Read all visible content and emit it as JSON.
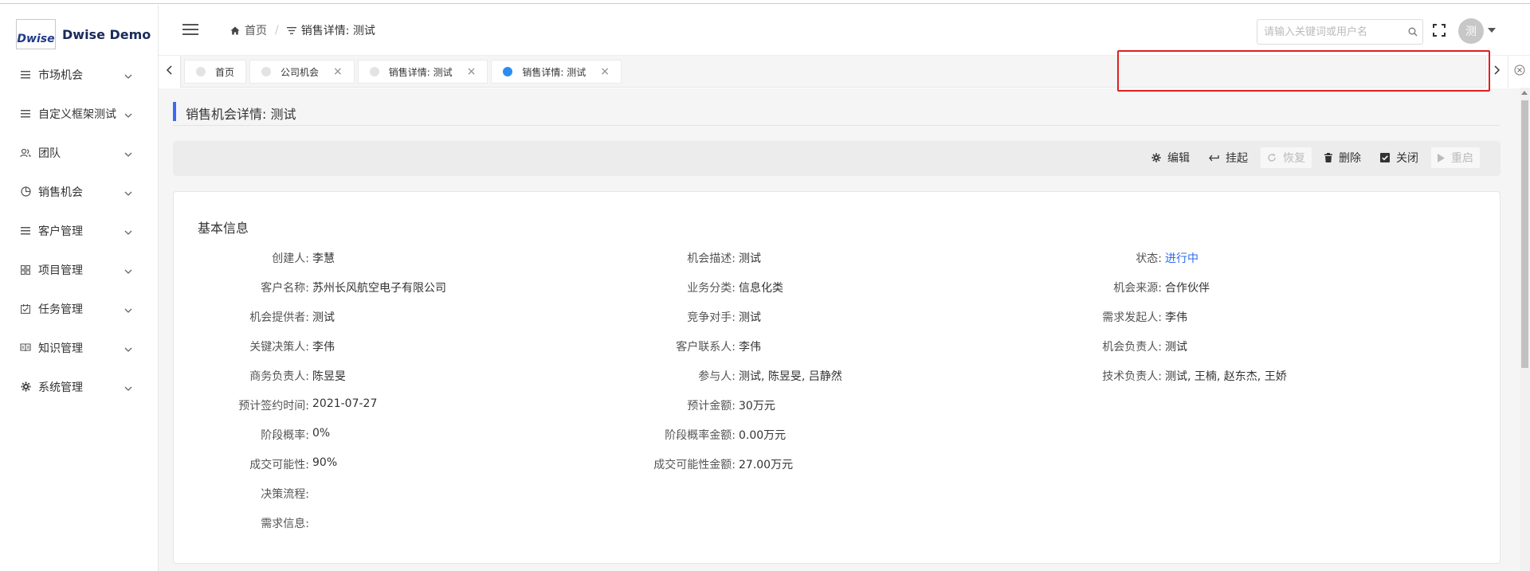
{
  "app": {
    "logo_mark": "Dwise",
    "name": "Dwise Demo"
  },
  "sidebar": {
    "items": [
      {
        "label": "市场机会",
        "icon": "list-icon"
      },
      {
        "label": "自定义框架测试",
        "icon": "list-icon"
      },
      {
        "label": "团队",
        "icon": "team-icon"
      },
      {
        "label": "销售机会",
        "icon": "pie-chart-icon"
      },
      {
        "label": "客户管理",
        "icon": "list-icon"
      },
      {
        "label": "项目管理",
        "icon": "grid-icon"
      },
      {
        "label": "任务管理",
        "icon": "checkbox-icon"
      },
      {
        "label": "知识管理",
        "icon": "book-icon"
      },
      {
        "label": "系统管理",
        "icon": "gear-icon"
      }
    ]
  },
  "header": {
    "breadcrumb": {
      "home": "首页",
      "current": "销售详情: 测试"
    },
    "search": {
      "placeholder": "请输入关键词或用户名",
      "value": ""
    },
    "avatar": "测"
  },
  "tabs": [
    {
      "label": "首页",
      "closable": false,
      "active": false
    },
    {
      "label": "公司机会",
      "closable": true,
      "active": false
    },
    {
      "label": "销售详情: 测试",
      "closable": true,
      "active": false
    },
    {
      "label": "销售详情: 测试",
      "closable": true,
      "active": true
    }
  ],
  "page": {
    "title": "销售机会详情: 测试"
  },
  "actions": {
    "edit": "编辑",
    "suspend": "挂起",
    "restore": "恢复",
    "delete": "删除",
    "close": "关闭",
    "restart": "重启"
  },
  "basic_info": {
    "title": "基本信息",
    "fields": {
      "creator": {
        "label": "创建人:",
        "value": "李慧"
      },
      "customer_name": {
        "label": "客户名称:",
        "value": "苏州长风航空电子有限公司"
      },
      "provider": {
        "label": "机会提供者:",
        "value": "测试"
      },
      "key_decision_maker": {
        "label": "关键决策人:",
        "value": "李伟"
      },
      "business_owner": {
        "label": "商务负责人:",
        "value": "陈昱旻"
      },
      "expected_sign_date": {
        "label": "预计签约时间:",
        "value": "2021-07-27"
      },
      "stage_probability": {
        "label": "阶段概率:",
        "value": "0%"
      },
      "deal_possibility": {
        "label": "成交可能性:",
        "value": "90%"
      },
      "decision_process": {
        "label": "决策流程:",
        "value": ""
      },
      "requirement_info": {
        "label": "需求信息:",
        "value": ""
      },
      "description": {
        "label": "机会描述:",
        "value": "测试"
      },
      "business_category": {
        "label": "业务分类:",
        "value": "信息化类"
      },
      "competitor": {
        "label": "竞争对手:",
        "value": "测试"
      },
      "customer_contact": {
        "label": "客户联系人:",
        "value": "李伟"
      },
      "participants": {
        "label": "参与人:",
        "value": "测试, 陈昱旻, 吕静然"
      },
      "expected_amount": {
        "label": "预计金额:",
        "value": "30万元"
      },
      "stage_probability_amount": {
        "label": "阶段概率金额:",
        "value": "0.00万元"
      },
      "deal_possibility_amount": {
        "label": "成交可能性金额:",
        "value": "27.00万元"
      },
      "status": {
        "label": "状态:",
        "value": "进行中"
      },
      "source": {
        "label": "机会来源:",
        "value": "合作伙伴"
      },
      "requirement_initiator": {
        "label": "需求发起人:",
        "value": "李伟"
      },
      "opportunity_owner": {
        "label": "机会负责人:",
        "value": "测试"
      },
      "tech_owner": {
        "label": "技术负责人:",
        "value": "测试, 王楠, 赵东杰, 王娇"
      }
    }
  },
  "colors": {
    "accent": "#3a6bf0",
    "link": "#2d6cf0",
    "active_tab_dot": "#2d8cf0",
    "highlight_border": "#e02020"
  }
}
